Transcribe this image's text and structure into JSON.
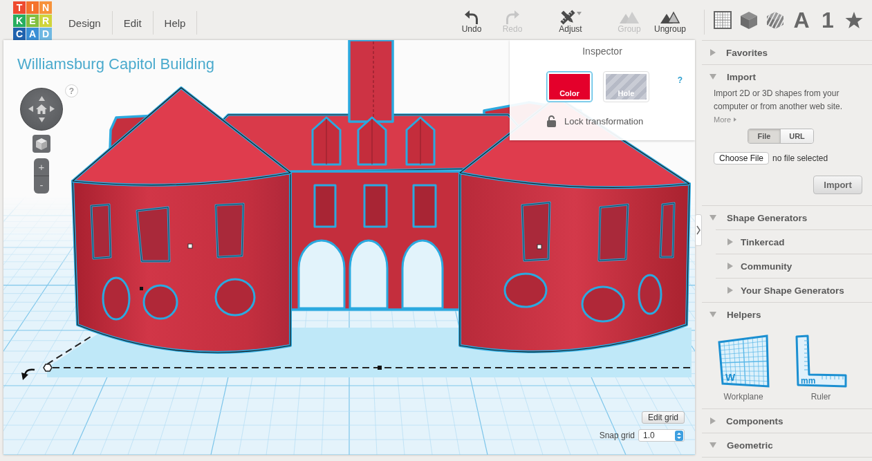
{
  "logo": {
    "tiles": [
      {
        "letter": "T",
        "color": "#ee4a2f"
      },
      {
        "letter": "I",
        "color": "#f5722c"
      },
      {
        "letter": "N",
        "color": "#f7923a"
      },
      {
        "letter": "K",
        "color": "#27ae5f"
      },
      {
        "letter": "E",
        "color": "#82bf3f"
      },
      {
        "letter": "R",
        "color": "#cfd43b"
      },
      {
        "letter": "C",
        "color": "#1f62ae"
      },
      {
        "letter": "A",
        "color": "#3a8fd6"
      },
      {
        "letter": "D",
        "color": "#6fb8e2"
      }
    ]
  },
  "menu": [
    {
      "label": "Design"
    },
    {
      "label": "Edit"
    },
    {
      "label": "Help"
    }
  ],
  "toolbar": [
    {
      "kind": "undo",
      "label": "Undo",
      "disabled": false
    },
    {
      "kind": "redo",
      "label": "Redo",
      "disabled": true
    },
    {
      "kind": "adjust",
      "label": "Adjust",
      "disabled": false
    },
    {
      "kind": "group",
      "label": "Group",
      "disabled": true
    },
    {
      "kind": "ungroup",
      "label": "Ungroup",
      "disabled": false
    }
  ],
  "shape_tabs": [
    {
      "kind": "grid"
    },
    {
      "kind": "cube"
    },
    {
      "kind": "striped-cube"
    },
    {
      "kind": "glyph",
      "label": "A"
    },
    {
      "kind": "glyph",
      "label": "1"
    },
    {
      "kind": "star"
    }
  ],
  "canvas": {
    "title": "Williamsburg Capitol Building",
    "view_help": "?",
    "zoom_in": "+",
    "zoom_out": "-",
    "edit_grid_button": "Edit grid",
    "snap_grid": {
      "label": "Snap grid",
      "value": "1.0"
    }
  },
  "inspector": {
    "title": "Inspector",
    "swatches": [
      {
        "kind": "color",
        "label": "Color",
        "selected": true
      },
      {
        "kind": "hole",
        "label": "Hole",
        "selected": false
      }
    ],
    "help": "?",
    "lock": {
      "label": "Lock transformation",
      "locked": false
    }
  },
  "sidebar": {
    "sections": [
      {
        "label": "Favorites",
        "expanded": false
      },
      {
        "kind": "import",
        "label": "Import",
        "expanded": true,
        "description": "Import 2D or 3D shapes from your computer or from another web site.",
        "more_link": "More",
        "source_tabs": [
          {
            "label": "File",
            "selected": true
          },
          {
            "label": "URL",
            "selected": false
          }
        ],
        "file_button": "Choose File",
        "file_status": "no file selected",
        "import_button": "Import"
      },
      {
        "kind": "generators",
        "label": "Shape Generators",
        "expanded": true,
        "children": [
          {
            "label": "Tinkercad",
            "expanded": false
          },
          {
            "label": "Community",
            "expanded": false
          },
          {
            "label": "Your Shape Generators",
            "expanded": false
          }
        ]
      },
      {
        "kind": "helpers",
        "label": "Helpers",
        "expanded": true,
        "items": [
          {
            "kind": "workplane",
            "label": "Workplane",
            "badge": "W"
          },
          {
            "kind": "ruler",
            "label": "Ruler",
            "badge": "mm"
          }
        ]
      },
      {
        "label": "Components",
        "expanded": false
      },
      {
        "label": "Geometric",
        "expanded": true
      }
    ]
  }
}
